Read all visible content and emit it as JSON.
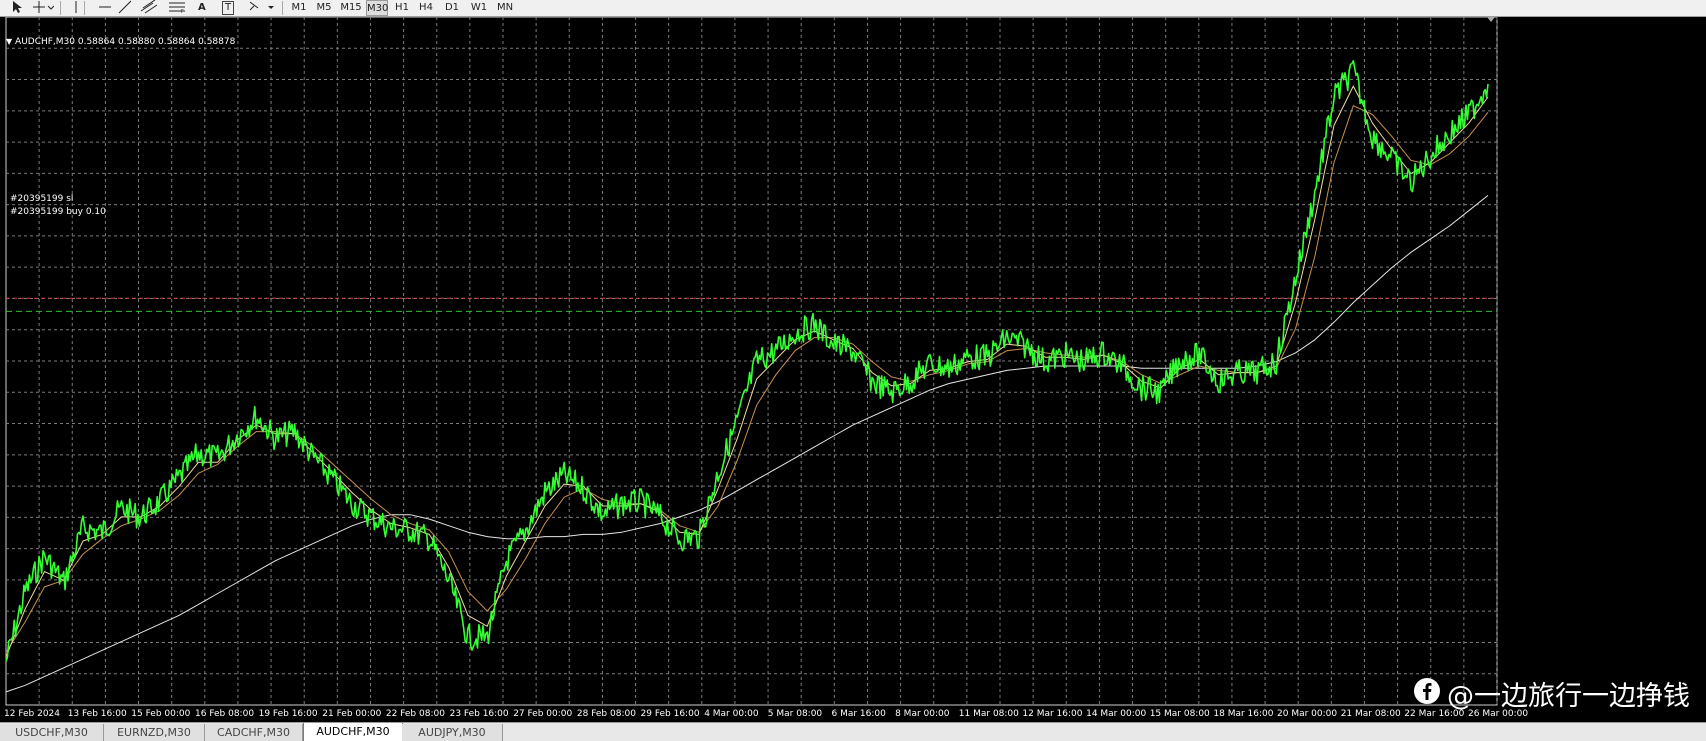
{
  "toolbar": {
    "timeframes": [
      "M1",
      "M5",
      "M15",
      "M30",
      "H1",
      "H4",
      "D1",
      "W1",
      "MN"
    ],
    "active_timeframe": "M30",
    "text_tool": "A",
    "label_tool": "T"
  },
  "chart": {
    "header": "AUDCHF,M30  0.58864 0.58880 0.58864 0.58878",
    "trade_lines": [
      {
        "label": "#20395199 sl",
        "color": "#d04040",
        "price": 0.5886
      },
      {
        "label": "#20395199 buy 0.10",
        "color": "#2fbf2f",
        "price": 0.588
      }
    ],
    "time_labels": [
      "12 Feb 2024",
      "13 Feb 16:00",
      "15 Feb 00:00",
      "16 Feb 08:00",
      "19 Feb 16:00",
      "21 Feb 00:00",
      "22 Feb 08:00",
      "23 Feb 16:00",
      "27 Feb 00:00",
      "28 Feb 08:00",
      "29 Feb 16:00",
      "4 Mar 00:00",
      "5 Mar 08:00",
      "6 Mar 16:00",
      "8 Mar 00:00",
      "11 Mar 08:00",
      "12 Mar 16:00",
      "14 Mar 00:00",
      "15 Mar 08:00",
      "18 Mar 16:00",
      "20 Mar 00:00",
      "21 Mar 08:00",
      "22 Mar 16:00",
      "26 Mar 00:00"
    ]
  },
  "colors": {
    "background": "#000000",
    "price_line": "#33ff33",
    "grid": "#7a7a7a",
    "ma_fast": "#f2dca0",
    "ma_mid": "#c89050",
    "ma_slow": "#e6e6e6"
  },
  "watermark": {
    "text": "@一边旅行一边挣钱",
    "icon": "facebook-icon"
  },
  "tabs": [
    "USDCHF,M30",
    "EURNZD,M30",
    "CADCHF,M30",
    "AUDCHF,M30",
    "AUDJPY,M30"
  ],
  "active_tab": "AUDCHF,M30",
  "chart_data": {
    "type": "line",
    "title": "AUDCHF,M30",
    "series": [
      {
        "values": [
          0.572,
          0.5752,
          0.5768,
          0.5756,
          0.5781,
          0.5779,
          0.579,
          0.5786,
          0.5793,
          0.5804,
          0.5815,
          0.5813,
          0.5823,
          0.5832,
          0.5822,
          0.5825,
          0.5813,
          0.5803,
          0.5792,
          0.5786,
          0.5781,
          0.578,
          0.5776,
          0.5757,
          0.5731,
          0.5731,
          0.5766,
          0.578,
          0.5797,
          0.5805,
          0.5799,
          0.5787,
          0.5792,
          0.5793,
          0.5786,
          0.5776,
          0.5777,
          0.5806,
          0.583,
          0.5857,
          0.5862,
          0.587,
          0.5874,
          0.5865,
          0.5862,
          0.5848,
          0.5843,
          0.5848,
          0.5856,
          0.5854,
          0.5859,
          0.5859,
          0.5868,
          0.5864,
          0.5857,
          0.586,
          0.5857,
          0.5861,
          0.5855,
          0.5845,
          0.5843,
          0.5858,
          0.586,
          0.5848,
          0.5852,
          0.5852,
          0.5857,
          0.5895,
          0.5934,
          0.5978,
          0.599,
          0.596,
          0.595,
          0.5939,
          0.5951,
          0.5961,
          0.597,
          0.5984
        ]
      }
    ],
    "ma_fast_values": [
      0.5722,
      0.5744,
      0.5761,
      0.5757,
      0.5775,
      0.5778,
      0.5786,
      0.5786,
      0.5791,
      0.58,
      0.5811,
      0.5811,
      0.5821,
      0.5828,
      0.5824,
      0.5824,
      0.5815,
      0.5806,
      0.5797,
      0.5789,
      0.5783,
      0.5781,
      0.5778,
      0.5763,
      0.5741,
      0.5736,
      0.5759,
      0.5775,
      0.5791,
      0.5801,
      0.58,
      0.5791,
      0.5791,
      0.5792,
      0.5788,
      0.5779,
      0.5778,
      0.5799,
      0.5822,
      0.5849,
      0.5858,
      0.5867,
      0.5871,
      0.5867,
      0.5863,
      0.5852,
      0.5846,
      0.5847,
      0.5853,
      0.5854,
      0.5857,
      0.5858,
      0.5865,
      0.5864,
      0.5859,
      0.5859,
      0.5858,
      0.586,
      0.5856,
      0.5848,
      0.5845,
      0.5854,
      0.5858,
      0.5851,
      0.5852,
      0.5852,
      0.5855,
      0.5884,
      0.5922,
      0.5965,
      0.5983,
      0.5966,
      0.5954,
      0.5943,
      0.5948,
      0.5957,
      0.5966,
      0.5978
    ],
    "ma_mid_values": [
      0.5724,
      0.5738,
      0.5754,
      0.5757,
      0.5769,
      0.5776,
      0.5782,
      0.5785,
      0.5789,
      0.5796,
      0.5806,
      0.581,
      0.5818,
      0.5825,
      0.5825,
      0.5824,
      0.5818,
      0.581,
      0.5802,
      0.5794,
      0.5787,
      0.5783,
      0.578,
      0.577,
      0.5752,
      0.5743,
      0.5753,
      0.5767,
      0.5783,
      0.5795,
      0.5799,
      0.5794,
      0.5792,
      0.5792,
      0.5789,
      0.5782,
      0.5779,
      0.5791,
      0.5812,
      0.5837,
      0.5851,
      0.5862,
      0.5868,
      0.5868,
      0.5865,
      0.5857,
      0.585,
      0.5848,
      0.5851,
      0.5853,
      0.5856,
      0.5857,
      0.5862,
      0.5863,
      0.5861,
      0.586,
      0.5859,
      0.586,
      0.5857,
      0.5851,
      0.5847,
      0.5851,
      0.5855,
      0.5853,
      0.5852,
      0.5852,
      0.5854,
      0.5872,
      0.5905,
      0.5948,
      0.5974,
      0.597,
      0.596,
      0.5949,
      0.5947,
      0.5952,
      0.596,
      0.5971
    ],
    "ma_slow_values": [
      0.5706,
      0.5709,
      0.5713,
      0.5717,
      0.5721,
      0.5725,
      0.5729,
      0.5733,
      0.5737,
      0.5741,
      0.5746,
      0.5751,
      0.5756,
      0.5761,
      0.5766,
      0.577,
      0.5774,
      0.5778,
      0.5782,
      0.5785,
      0.5787,
      0.5787,
      0.5785,
      0.5782,
      0.5779,
      0.5777,
      0.5776,
      0.5776,
      0.5777,
      0.5777,
      0.5778,
      0.5778,
      0.5779,
      0.5781,
      0.5783,
      0.5786,
      0.5789,
      0.5793,
      0.5798,
      0.5803,
      0.5808,
      0.5813,
      0.5818,
      0.5823,
      0.5828,
      0.5832,
      0.5836,
      0.584,
      0.5844,
      0.5847,
      0.5849,
      0.5851,
      0.5853,
      0.5854,
      0.5855,
      0.5855,
      0.5855,
      0.5855,
      0.5855,
      0.5854,
      0.5854,
      0.5854,
      0.5854,
      0.5854,
      0.5854,
      0.5855,
      0.5857,
      0.5861,
      0.5867,
      0.5875,
      0.5884,
      0.5892,
      0.59,
      0.5907,
      0.5913,
      0.5919,
      0.5926,
      0.5933
    ],
    "ylim": [
      0.57,
      0.601
    ],
    "grid": true
  }
}
